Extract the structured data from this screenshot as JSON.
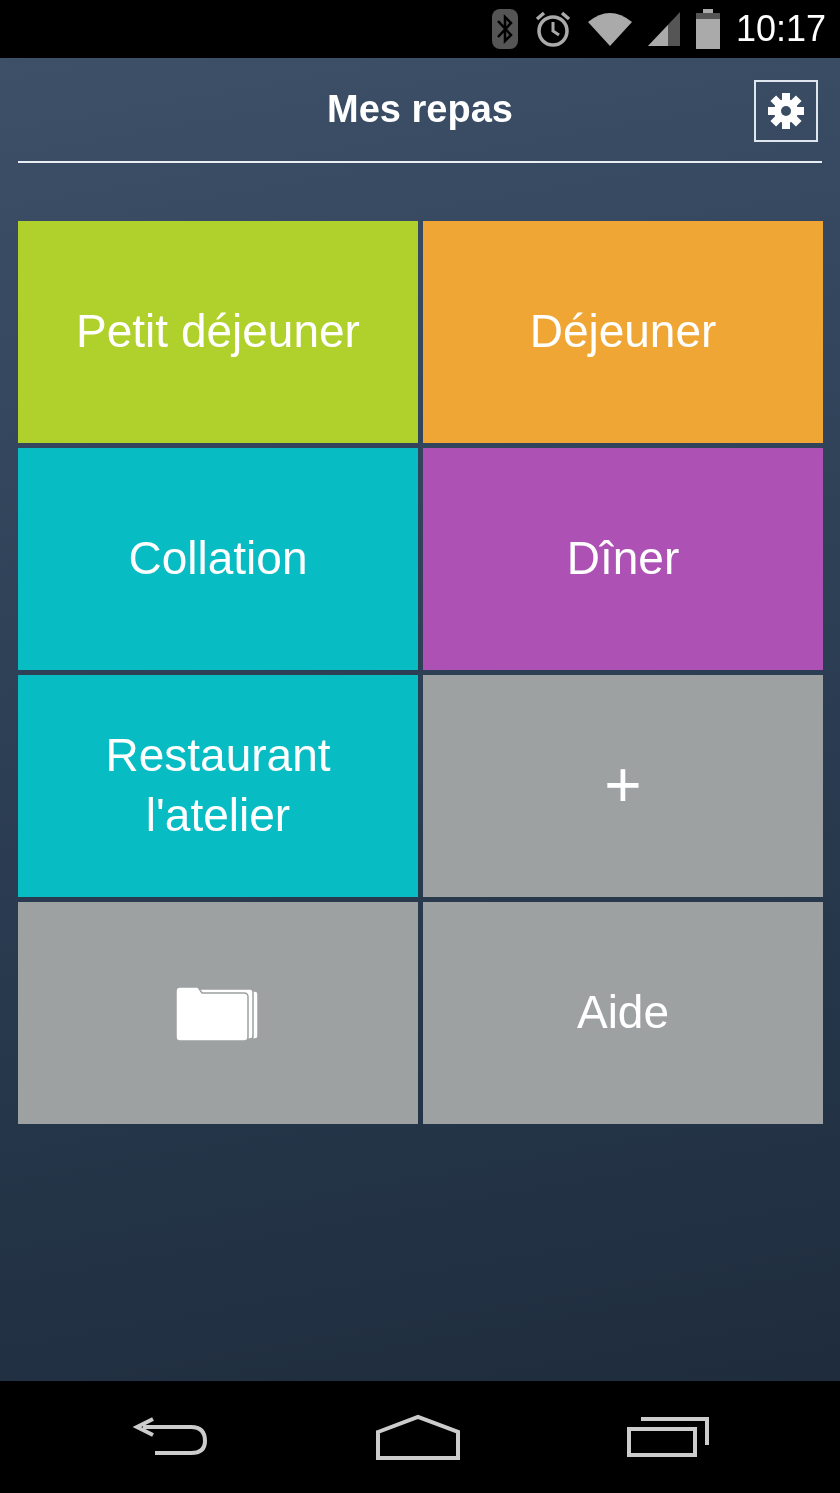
{
  "status_bar": {
    "time": "10:17"
  },
  "header": {
    "title": "Mes repas"
  },
  "tiles": [
    {
      "kind": "text",
      "label": "Petit déjeuner",
      "color": "#b0d02c"
    },
    {
      "kind": "text",
      "label": "Déjeuner",
      "color": "#efa634"
    },
    {
      "kind": "text",
      "label": "Collation",
      "color": "#08bcc4"
    },
    {
      "kind": "text",
      "label": "Dîner",
      "color": "#ae51b4"
    },
    {
      "kind": "text",
      "label": "Restaurant l'atelier",
      "color": "#08bcc4"
    },
    {
      "kind": "text",
      "label": "+",
      "color": "#9da1a2"
    },
    {
      "kind": "folder",
      "color": "#9da1a2"
    },
    {
      "kind": "text",
      "label": "Aide",
      "color": "#9da1a2"
    }
  ]
}
